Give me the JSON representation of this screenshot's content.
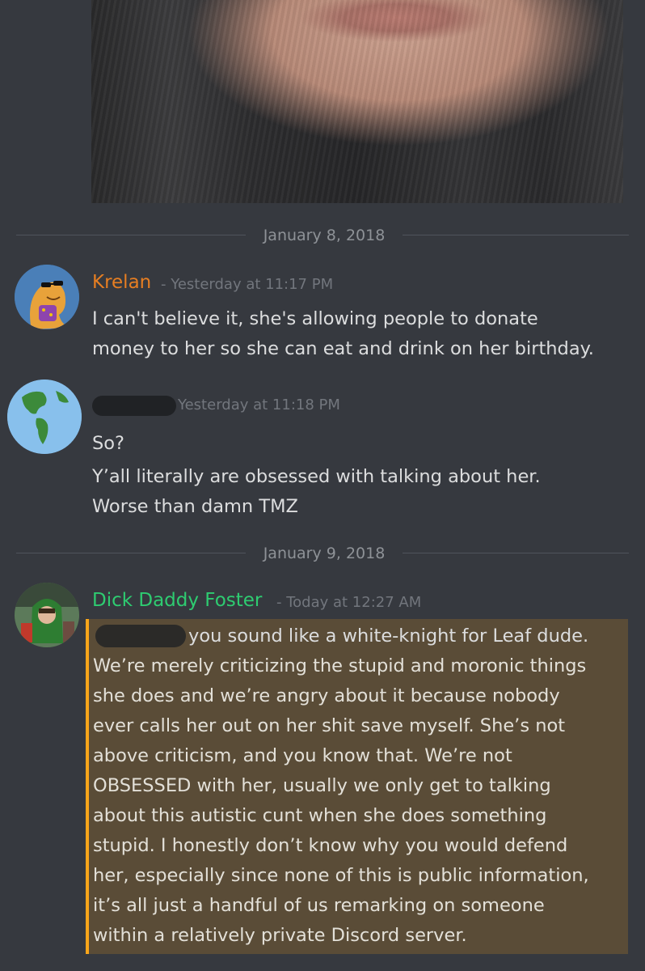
{
  "colors": {
    "background": "#36393f",
    "mention_bg": "#5a4c37",
    "mention_border": "#faa61a"
  },
  "dividers": {
    "first": "January 8, 2018",
    "second": "January 9, 2018"
  },
  "messages": [
    {
      "author": "Krelan",
      "author_color": "#e67e22",
      "timestamp": "- Yesterday at 11:17 PM",
      "avatar": "slug-character-avatar",
      "lines": [
        "I can't believe it, she's allowing people to donate",
        "money to her so she can eat and drink on her birthday."
      ]
    },
    {
      "author": "",
      "timestamp": "Yesterday at 11:18 PM",
      "avatar": "earth-globe-avatar",
      "lines": [
        "So?",
        "Y’all literally are obsessed with talking about her.",
        "Worse than damn TMZ"
      ]
    },
    {
      "author": "Dick Daddy Foster",
      "author_color": "#2ecc71",
      "timestamp": "- Today at 12:27 AM",
      "avatar": "cartoon-character-avatar",
      "lines": [
        "you sound like a white-knight for Leaf dude.",
        "We’re merely criticizing the stupid and moronic things",
        "she does and we’re angry about it because nobody",
        "ever calls her out on her shit save myself. She’s not",
        "above criticism, and you know that. We’re not",
        "OBSESSED with her, usually we only get to talking",
        "about this autistic cunt when she does something",
        "stupid. I honestly don’t know why you would defend",
        "her, especially since none of this is public information,",
        "it’s all just a handful of us remarking on someone",
        "within a relatively private Discord server."
      ]
    }
  ]
}
